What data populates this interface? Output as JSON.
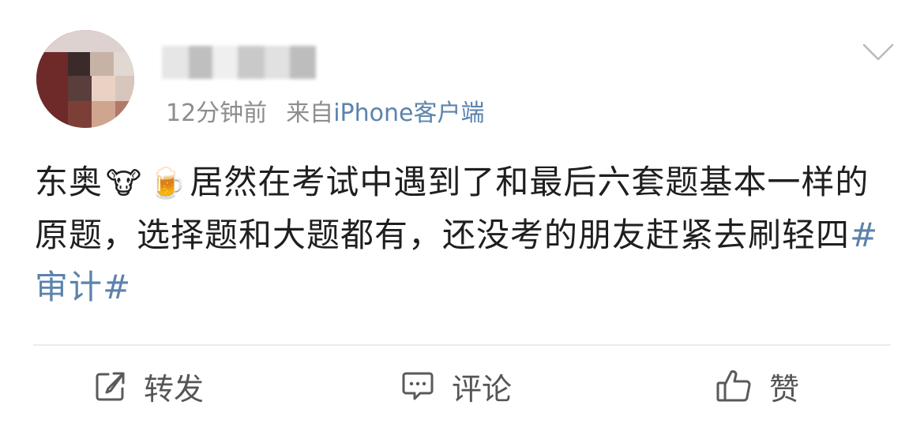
{
  "post": {
    "time": "12分钟前",
    "source_prefix": "来自",
    "source_link": "iPhone客户端",
    "content": {
      "line1_pre": "东奥",
      "emoji1": "🐮",
      "emoji2": "🍺",
      "text_main": "居然在考试中遇到了和最后六套题基本一样的原题，选择题和大题都有，还没考的朋友赶紧去刷轻四",
      "hashtag": "#审计#"
    },
    "actions": {
      "repost_label": "转发",
      "comment_label": "评论",
      "like_label": "赞"
    },
    "colors": {
      "link": "#5b83ad",
      "meta": "#8d8d8d",
      "divider": "#ececec"
    },
    "icons": [
      "chevron-down-icon",
      "repost-icon",
      "comment-icon",
      "like-icon"
    ]
  }
}
